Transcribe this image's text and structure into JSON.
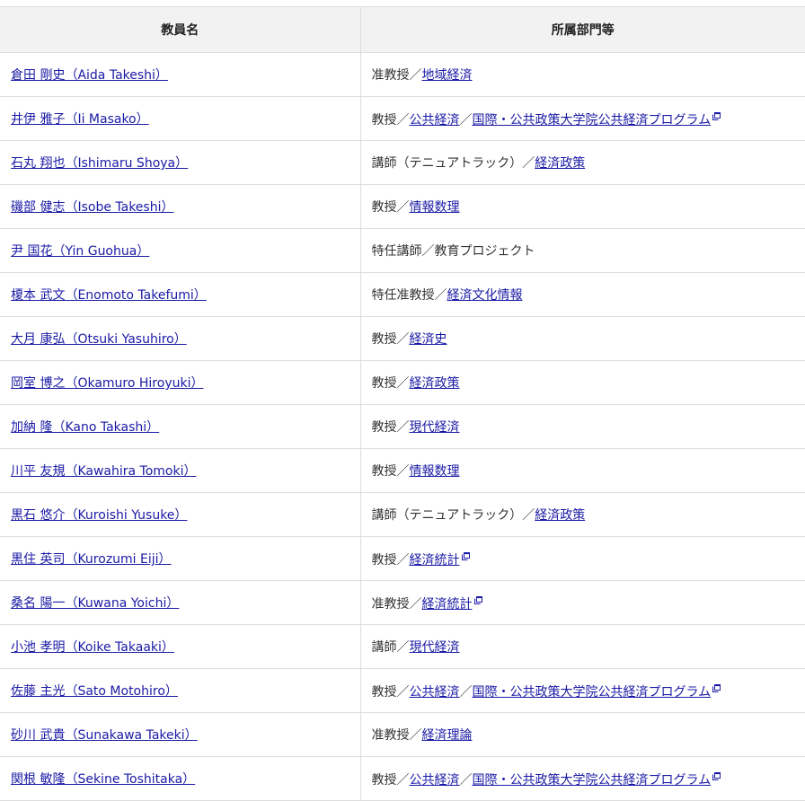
{
  "table": {
    "headers": [
      "教員名",
      "所属部門等"
    ],
    "rows": [
      {
        "name": "倉田 剛史（Aida Takeshi）",
        "title": "准教授",
        "depts": [
          {
            "label": "地域経済",
            "ext": false
          }
        ]
      },
      {
        "name": "井伊 雅子（Ii Masako）",
        "title": "教授",
        "depts": [
          {
            "label": "公共経済",
            "ext": false
          },
          {
            "label": "国際・公共政策大学院公共経済プログラム",
            "ext": true
          }
        ]
      },
      {
        "name": "石丸 翔也（Ishimaru Shoya）",
        "title": "講師（テニュアトラック）",
        "depts": [
          {
            "label": "経済政策",
            "ext": false
          }
        ]
      },
      {
        "name": "磯部 健志（Isobe Takeshi）",
        "title": "教授",
        "depts": [
          {
            "label": "情報数理",
            "ext": false
          }
        ]
      },
      {
        "name": "尹 国花（Yin Guohua）",
        "title": "特任講師／教育プロジェクト",
        "depts": []
      },
      {
        "name": "榎本 武文（Enomoto Takefumi）",
        "title": "特任准教授",
        "depts": [
          {
            "label": "経済文化情報",
            "ext": false
          }
        ]
      },
      {
        "name": "大月 康弘（Otsuki Yasuhiro）",
        "title": "教授",
        "depts": [
          {
            "label": "経済史",
            "ext": false
          }
        ]
      },
      {
        "name": "岡室 博之（Okamuro Hiroyuki）",
        "title": "教授",
        "depts": [
          {
            "label": "経済政策",
            "ext": false
          }
        ]
      },
      {
        "name": "加納 隆（Kano Takashi）",
        "title": "教授",
        "depts": [
          {
            "label": "現代経済",
            "ext": false
          }
        ]
      },
      {
        "name": "川平 友規（Kawahira Tomoki）",
        "title": "教授",
        "depts": [
          {
            "label": "情報数理",
            "ext": false
          }
        ]
      },
      {
        "name": "黒石 悠介（Kuroishi Yusuke）",
        "title": "講師（テニュアトラック）",
        "depts": [
          {
            "label": "経済政策",
            "ext": false
          }
        ]
      },
      {
        "name": "黒住 英司（Kurozumi Eiji）",
        "title": "教授",
        "depts": [
          {
            "label": "経済統計",
            "ext": true
          }
        ]
      },
      {
        "name": "桑名 陽一（Kuwana Yoichi）",
        "title": "准教授",
        "depts": [
          {
            "label": "経済統計",
            "ext": true
          }
        ]
      },
      {
        "name": "小池 孝明（Koike Takaaki）",
        "title": "講師",
        "depts": [
          {
            "label": "現代経済",
            "ext": false
          }
        ]
      },
      {
        "name": "佐藤 主光（Sato Motohiro）",
        "title": "教授",
        "depts": [
          {
            "label": "公共経済",
            "ext": false
          },
          {
            "label": "国際・公共政策大学院公共経済プログラム",
            "ext": true
          }
        ]
      },
      {
        "name": "砂川 武貴（Sunakawa Takeki）",
        "title": "准教授",
        "depts": [
          {
            "label": "経済理論",
            "ext": false
          }
        ]
      },
      {
        "name": "関根 敏隆（Sekine Toshitaka）",
        "title": "教授",
        "depts": [
          {
            "label": "公共経済",
            "ext": false
          },
          {
            "label": "国際・公共政策大学院公共経済プログラム",
            "ext": true
          }
        ]
      }
    ]
  },
  "separator": "／",
  "icons": {
    "external_link": "external-link-icon"
  },
  "colors": {
    "link": "#1a1aa6",
    "header_bg": "#f2f2f2",
    "border": "#dddddd",
    "text": "#333333"
  }
}
